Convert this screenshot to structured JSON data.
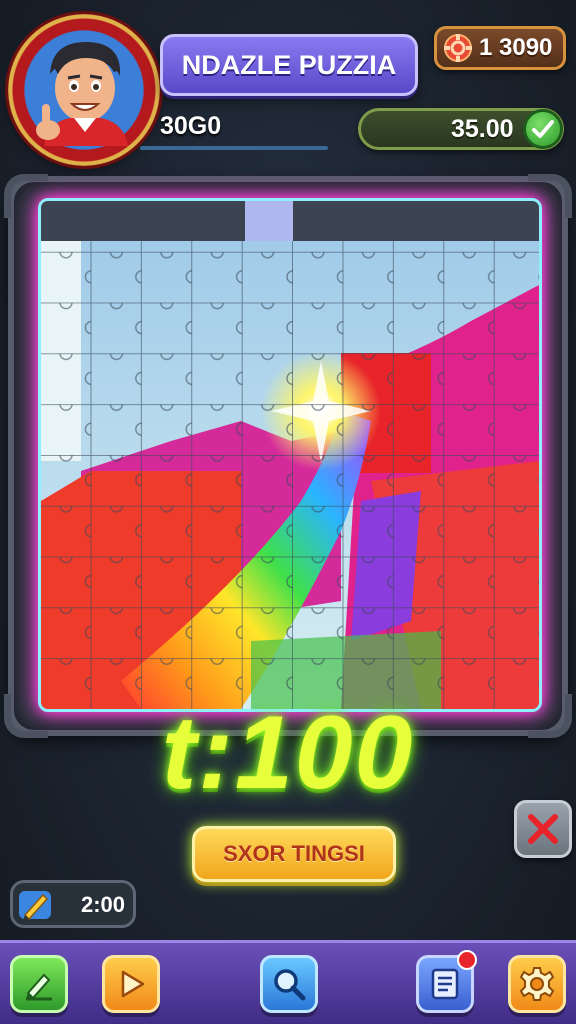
{
  "header": {
    "title": "NDAZLE PUZZIA",
    "score": "30G0",
    "coins": "1 3090",
    "progress_value": "35.00"
  },
  "game": {
    "big_timer": "t:100",
    "action_button": "SXOR TINGSI",
    "clock_value": "2:00"
  },
  "toolbar": {
    "items": [
      "pencil-icon",
      "play-icon",
      "search-icon",
      "document-icon",
      "gear-icon"
    ]
  },
  "colors": {
    "title_plate": "#6a5ae0",
    "timer_glow": "#e7ff3a",
    "action_button": "#f5b52a",
    "bottom_bar": "#5a40a8"
  }
}
